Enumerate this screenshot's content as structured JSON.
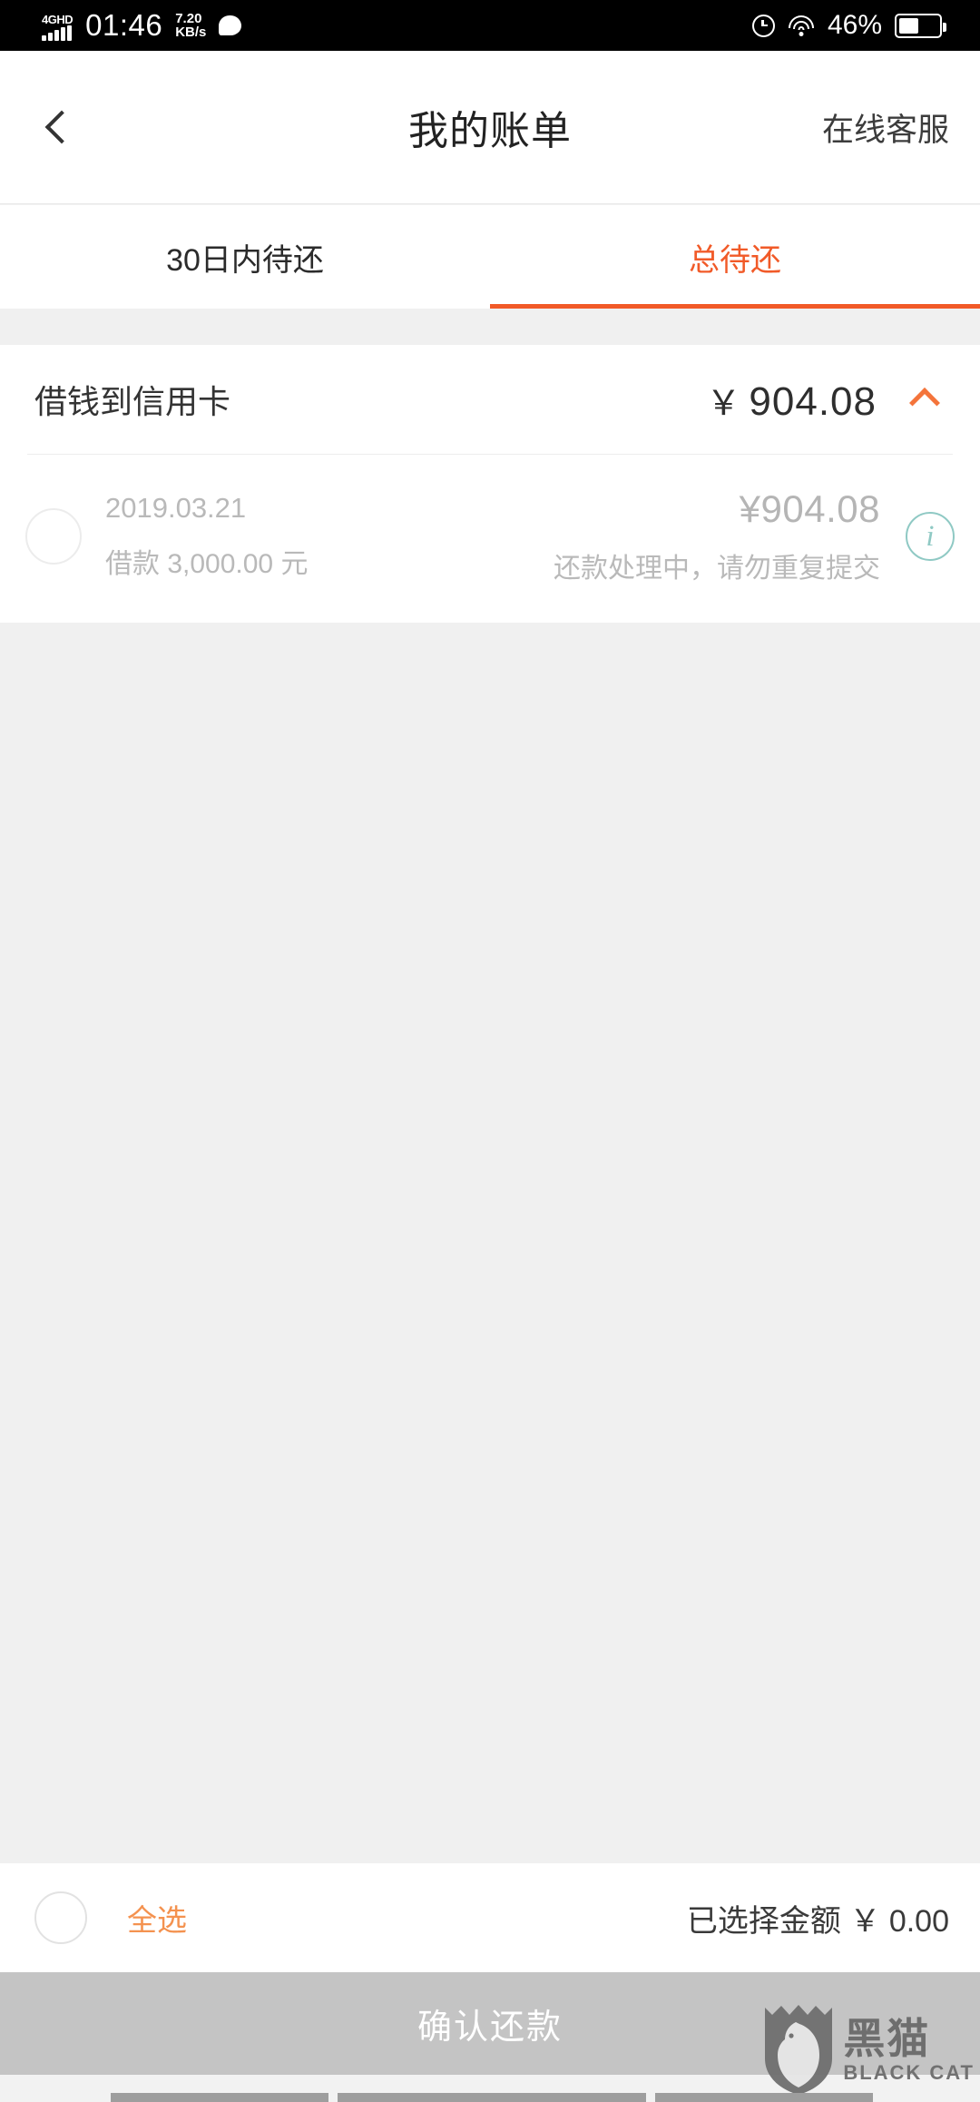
{
  "statusbar": {
    "network": "4GHD",
    "time": "01:46",
    "speed_value": "7.20",
    "speed_unit": "KB/s",
    "message_icon": "message-bubble-icon",
    "alarm_icon": "alarm-clock-icon",
    "wifi_icon": "wifi-icon",
    "battery_percent": "46%",
    "battery_icon": "battery-icon"
  },
  "header": {
    "back_icon": "chevron-left-icon",
    "title": "我的账单",
    "action_label": "在线客服"
  },
  "tabs": [
    {
      "label": "30日内待还",
      "active": false
    },
    {
      "label": "总待还",
      "active": true
    }
  ],
  "card": {
    "title": "借钱到信用卡",
    "currency": "￥",
    "total_amount": "904.08",
    "collapse_icon": "chevron-up-icon",
    "rows": [
      {
        "checkbox": "row-checkbox",
        "date": "2019.03.21",
        "principal": "借款 3,000.00 元",
        "amount": "¥904.08",
        "status": "还款处理中，请勿重复提交",
        "info_icon": "info-icon",
        "info_glyph": "i"
      }
    ]
  },
  "bottom_bar": {
    "select_all_checkbox": "select-all-checkbox",
    "select_all_label": "全选",
    "selected_amount_label": "已选择金额 ￥ 0.00"
  },
  "confirm_button": {
    "label": "确认还款"
  },
  "watermark": {
    "cn": "黑猫",
    "en": "BLACK CAT"
  },
  "colors": {
    "accent_orange": "#f15a28",
    "tab_active": "#f15a28",
    "select_all_orange": "#f4924f",
    "info_teal": "#8fc9c4",
    "confirm_bg": "#c4c4c4",
    "page_bg": "#f0f0f0"
  }
}
